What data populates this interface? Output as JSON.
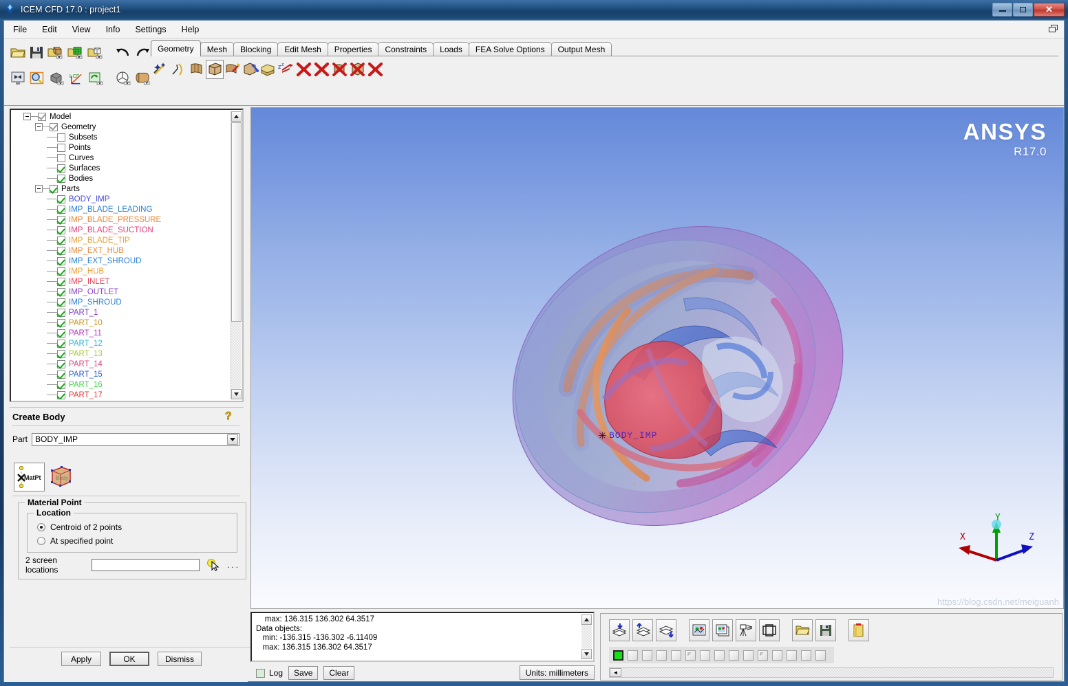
{
  "window": {
    "title": "ICEM CFD 17.0 : project1",
    "app_icon": "ansys-icem-icon",
    "minimize": "minimize-button",
    "maximize": "maximize-button",
    "close": "close-button"
  },
  "menubar": {
    "items": [
      "File",
      "Edit",
      "View",
      "Info",
      "Settings",
      "Help"
    ]
  },
  "toolbar": {
    "file_icons": [
      "open-folder-icon",
      "save-icon",
      "open-geometry-icon",
      "open-mesh-icon",
      "open-blocking-icon",
      "undo-icon",
      "redo-icon"
    ],
    "view_icons": [
      "fit-window-icon",
      "zoom-box-icon",
      "measure-icon",
      "local-coord-system-icon",
      "refresh-icon",
      "cut-plane-icon",
      "solid-view-icon"
    ]
  },
  "tabs": {
    "items": [
      "Geometry",
      "Mesh",
      "Blocking",
      "Edit Mesh",
      "Properties",
      "Constraints",
      "Loads",
      "FEA Solve Options",
      "Output Mesh"
    ],
    "active": "Geometry",
    "geometry_icons": [
      "create-point-icon",
      "create-curve-icon",
      "create-surface-icon",
      "create-body-icon",
      "repair-geometry-icon",
      "transform-geometry-icon",
      "restore-dormant-icon",
      "translate-icon",
      "delete-point-icon",
      "delete-curve-icon",
      "delete-surface-icon",
      "delete-body-icon",
      "delete-any-icon"
    ],
    "selected_geometry_icon": "create-body-icon"
  },
  "tree": {
    "root": {
      "label": "Model",
      "checked": "partial"
    },
    "geometry": {
      "label": "Geometry",
      "checked": "partial",
      "children": [
        {
          "label": "Subsets",
          "checked": false,
          "color": "#000000"
        },
        {
          "label": "Points",
          "checked": false,
          "color": "#000000"
        },
        {
          "label": "Curves",
          "checked": false,
          "color": "#000000"
        },
        {
          "label": "Surfaces",
          "checked": true,
          "color": "#000000"
        },
        {
          "label": "Bodies",
          "checked": true,
          "color": "#000000"
        }
      ]
    },
    "parts": {
      "label": "Parts",
      "checked": true,
      "children": [
        {
          "label": "BODY_IMP",
          "checked": true,
          "color": "#4949d8"
        },
        {
          "label": "IMP_BLADE_LEADING",
          "checked": true,
          "color": "#2a7fd4"
        },
        {
          "label": "IMP_BLADE_PRESSURE",
          "checked": true,
          "color": "#e8883a"
        },
        {
          "label": "IMP_BLADE_SUCTION",
          "checked": true,
          "color": "#e0427e"
        },
        {
          "label": "IMP_BLADE_TIP",
          "checked": true,
          "color": "#e8a13a"
        },
        {
          "label": "IMP_EXT_HUB",
          "checked": true,
          "color": "#e8883a"
        },
        {
          "label": "IMP_EXT_SHROUD",
          "checked": true,
          "color": "#2a7fd4"
        },
        {
          "label": "IMP_HUB",
          "checked": true,
          "color": "#e8a13a"
        },
        {
          "label": "IMP_INLET",
          "checked": true,
          "color": "#e8425a"
        },
        {
          "label": "IMP_OUTLET",
          "checked": true,
          "color": "#8a3fc4"
        },
        {
          "label": "IMP_SHROUD",
          "checked": true,
          "color": "#2a7fd4"
        },
        {
          "label": "PART_1",
          "checked": true,
          "color": "#7a3fc8"
        },
        {
          "label": "PART_10",
          "checked": true,
          "color": "#c9921f"
        },
        {
          "label": "PART_11",
          "checked": true,
          "color": "#b035c0"
        },
        {
          "label": "PART_12",
          "checked": true,
          "color": "#2fb6d8"
        },
        {
          "label": "PART_13",
          "checked": true,
          "color": "#a8c93a"
        },
        {
          "label": "PART_14",
          "checked": true,
          "color": "#e0427e"
        },
        {
          "label": "PART_15",
          "checked": true,
          "color": "#2a5fd4"
        },
        {
          "label": "PART_16",
          "checked": true,
          "color": "#3fd44a"
        },
        {
          "label": "PART_17",
          "checked": true,
          "color": "#e83a3a"
        }
      ]
    }
  },
  "create_body": {
    "title": "Create Body",
    "help_icon": "help-question-icon",
    "part_label": "Part",
    "part_value": "BODY_IMP",
    "method_icons": [
      "material-point-icon",
      "body-from-surfaces-icon"
    ],
    "selected_method": "material-point-icon",
    "material_point": {
      "group_label": "Material Point",
      "location_label": "Location",
      "options": [
        "Centroid of 2 points",
        "At specified point"
      ],
      "selected": "Centroid of 2 points",
      "screen_locations_label": "2 screen locations",
      "screen_locations_value": "",
      "select_cursor_icon": "select-cursor-icon",
      "more_button": "..."
    },
    "buttons": {
      "apply": "Apply",
      "ok": "OK",
      "dismiss": "Dismiss"
    }
  },
  "viewport": {
    "logo": "ANSYS",
    "release": "R17.0",
    "body_label": "BODY_IMP",
    "body_marker": "material-point-star-icon",
    "axes": {
      "x": "X",
      "y": "Y",
      "z": "Z"
    },
    "watermark": "https://blog.csdn.net/meiguanh",
    "colors": {
      "bg_top": "#6489d9",
      "bg_bottom": "#fafbfe",
      "axis_x": "#b00000",
      "axis_y": "#00a000",
      "axis_z": "#1010c0"
    }
  },
  "message_area": {
    "lines": [
      "    max: 136.315 136.302 64.3517",
      "Data objects:",
      "   min: -136.315 -136.302 -6.11409",
      "   max: 136.315 136.302 64.3517"
    ],
    "log_checkbox_label": "Log",
    "log_checked": false,
    "save_button": "Save",
    "clear_button": "Clear",
    "units": "Units: millimeters"
  },
  "bottom_toolbar": {
    "buttons": [
      "add-to-layer-icon",
      "remove-from-layer-icon",
      "reorder-layers-icon",
      "display-single-icon",
      "display-multiple-icon",
      "camera-view-icon",
      "frame-view-icon",
      "open-view-icon",
      "save-view-icon",
      "notes-icon"
    ],
    "layer_checkboxes": [
      {
        "state": "active"
      },
      {
        "state": "empty"
      },
      {
        "state": "empty"
      },
      {
        "state": "empty"
      },
      {
        "state": "empty"
      },
      {
        "state": "partial"
      },
      {
        "state": "empty"
      },
      {
        "state": "empty"
      },
      {
        "state": "empty"
      },
      {
        "state": "empty"
      },
      {
        "state": "partial"
      },
      {
        "state": "empty"
      },
      {
        "state": "empty"
      },
      {
        "state": "empty"
      },
      {
        "state": "empty"
      }
    ]
  }
}
